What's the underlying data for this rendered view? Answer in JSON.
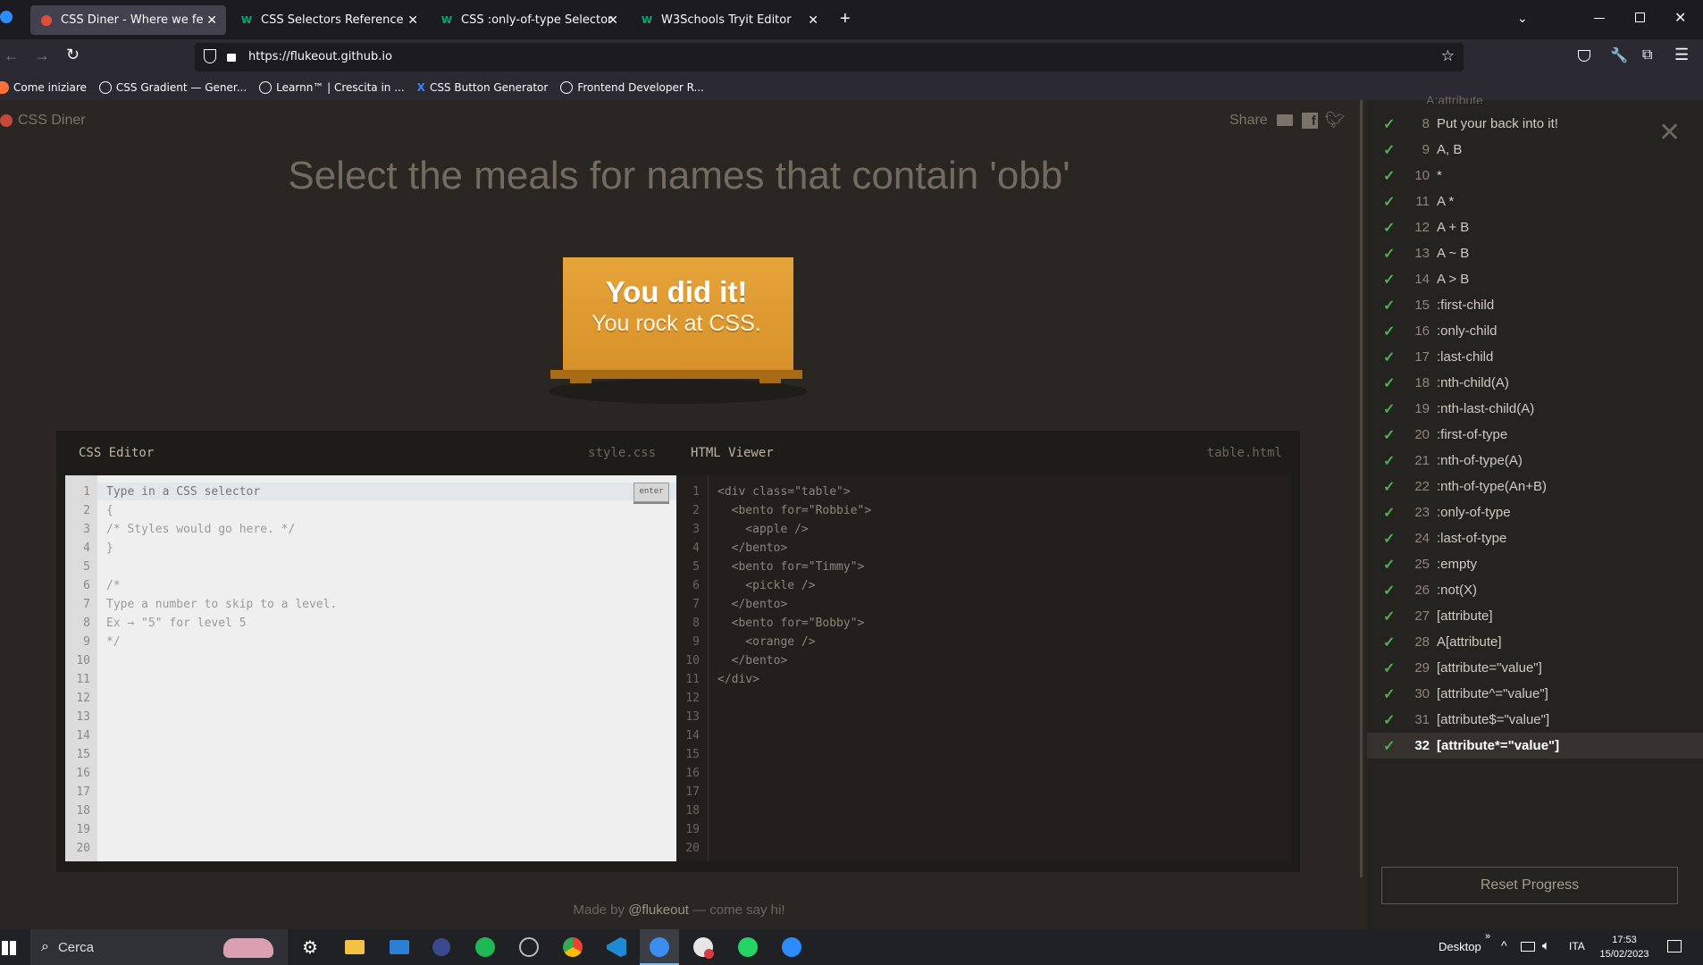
{
  "browser": {
    "tabs": [
      {
        "label": "CSS Diner - Where we feast on CSS",
        "active": true
      },
      {
        "label": "CSS Selectors Reference",
        "active": false
      },
      {
        "label": "CSS :only-of-type Selector",
        "active": false
      },
      {
        "label": "W3Schools Tryit Editor",
        "active": false
      }
    ],
    "url": "https://flukeout.github.io",
    "bookmarks": [
      "Come iniziare",
      "CSS Gradient — Gener...",
      "Learnn™ | Crescita in ...",
      "CSS Button Generator",
      "Frontend Developer R..."
    ]
  },
  "game": {
    "logo": "CSS Diner",
    "share_label": "Share",
    "instruction": "Select the meals for names that contain 'obb'",
    "win_line1": "You did it!",
    "win_line2": "You rock at CSS.",
    "css_editor_title": "CSS Editor",
    "css_editor_file": "style.css",
    "html_viewer_title": "HTML Viewer",
    "html_viewer_file": "table.html",
    "enter_label": "enter",
    "input_placeholder": "Type in a CSS selector",
    "css_lines": [
      "{",
      "/* Styles would go here. */",
      "}",
      "",
      "/*",
      "Type a number to skip to a level.",
      "Ex → \"5\" for level 5",
      "*/"
    ],
    "html_lines": [
      "<div class=\"table\">",
      "  <bento for=\"Robbie\">",
      "    <apple />",
      "  </bento>",
      "  <bento for=\"Timmy\">",
      "    <pickle />",
      "  </bento>",
      "  <bento for=\"Bobby\">",
      "    <orange />",
      "  </bento>",
      "</div>"
    ],
    "footer_made_by": "Made by ",
    "footer_author": "@flukeout",
    "footer_tail": " — come say hi!"
  },
  "levels": [
    {
      "num": "8",
      "label": "Put your back into it!"
    },
    {
      "num": "9",
      "label": "A, B"
    },
    {
      "num": "10",
      "label": "*"
    },
    {
      "num": "11",
      "label": "A *"
    },
    {
      "num": "12",
      "label": "A + B"
    },
    {
      "num": "13",
      "label": "A ~ B"
    },
    {
      "num": "14",
      "label": "A > B"
    },
    {
      "num": "15",
      "label": ":first-child"
    },
    {
      "num": "16",
      "label": ":only-child"
    },
    {
      "num": "17",
      "label": ":last-child"
    },
    {
      "num": "18",
      "label": ":nth-child(A)"
    },
    {
      "num": "19",
      "label": ":nth-last-child(A)"
    },
    {
      "num": "20",
      "label": ":first-of-type"
    },
    {
      "num": "21",
      "label": ":nth-of-type(A)"
    },
    {
      "num": "22",
      "label": ":nth-of-type(An+B)"
    },
    {
      "num": "23",
      "label": ":only-of-type"
    },
    {
      "num": "24",
      "label": ":last-of-type"
    },
    {
      "num": "25",
      "label": ":empty"
    },
    {
      "num": "26",
      "label": ":not(X)"
    },
    {
      "num": "27",
      "label": "[attribute]"
    },
    {
      "num": "28",
      "label": "A[attribute]"
    },
    {
      "num": "29",
      "label": "[attribute=\"value\"]"
    },
    {
      "num": "30",
      "label": "[attribute^=\"value\"]"
    },
    {
      "num": "31",
      "label": "[attribute$=\"value\"]"
    },
    {
      "num": "32",
      "label": "[attribute*=\"value\"]"
    }
  ],
  "current_level": "32",
  "reset_label": "Reset Progress",
  "taskbar": {
    "search_label": "Cerca",
    "desktop_label": "Desktop",
    "lang": "ITA",
    "time": "17:53",
    "date": "15/02/2023"
  }
}
